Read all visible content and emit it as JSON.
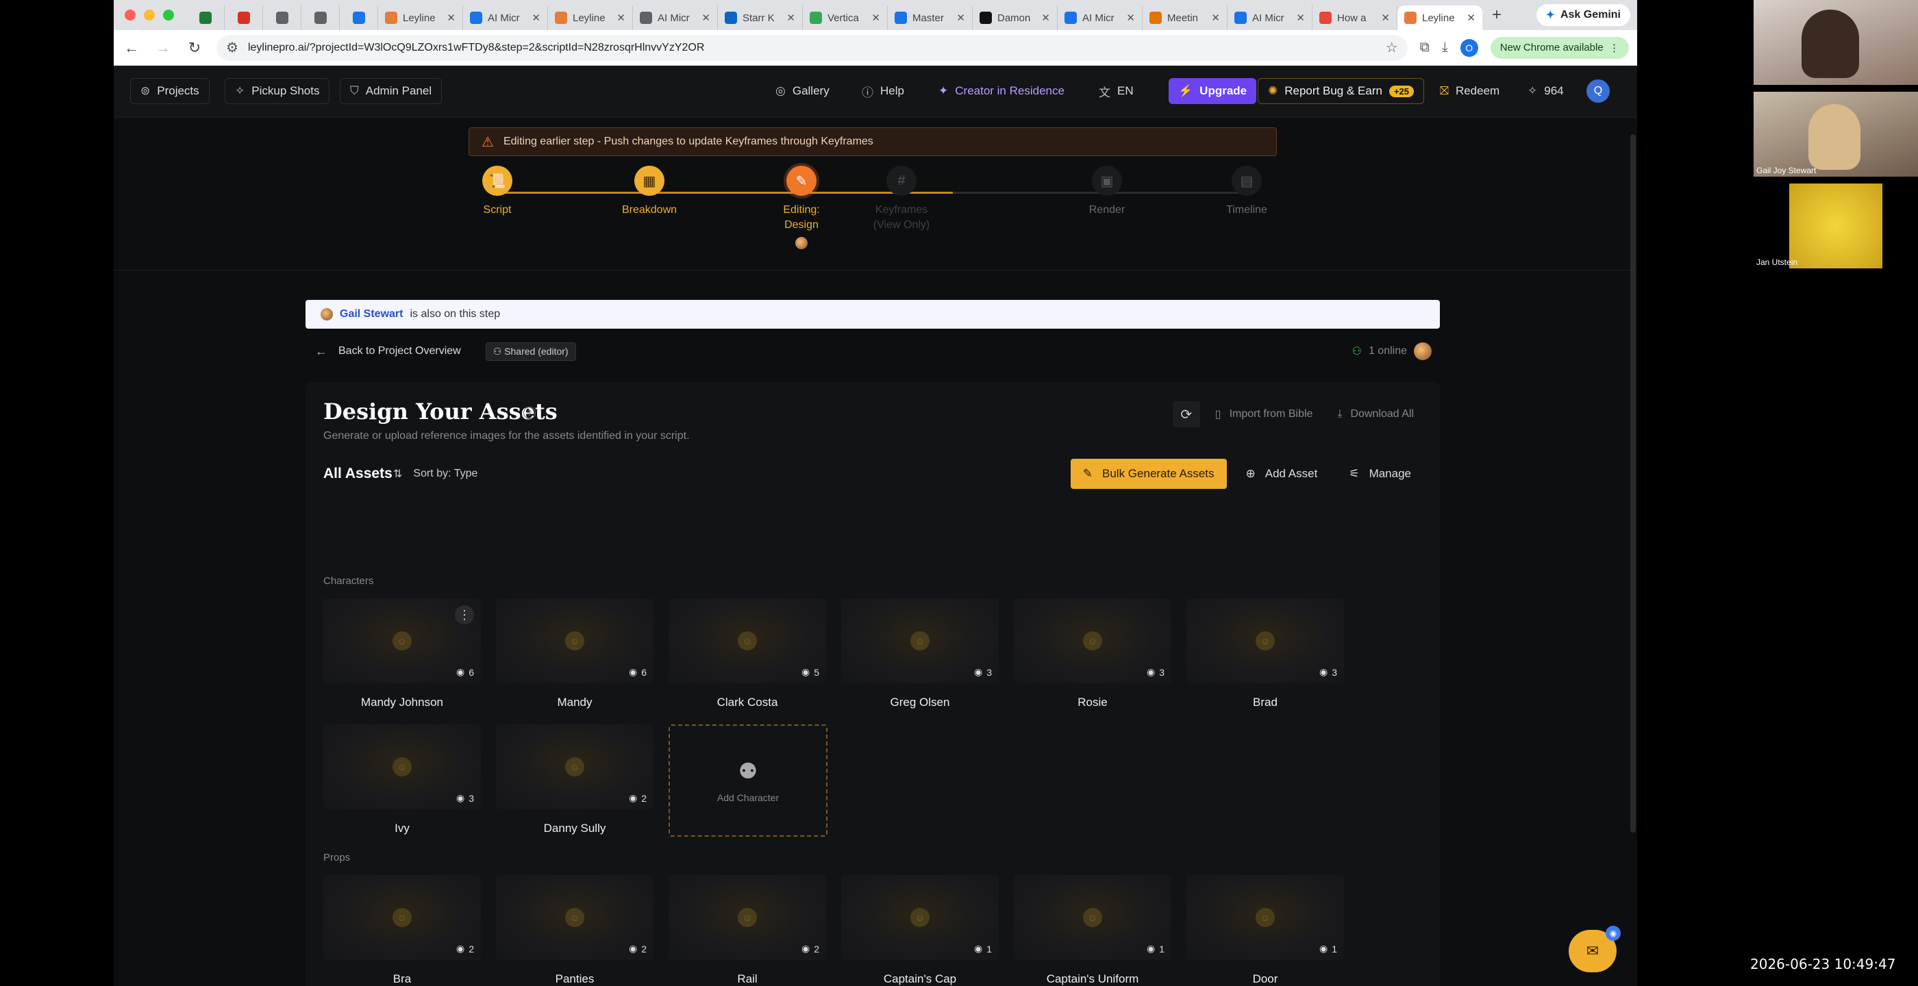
{
  "browser": {
    "tabs": [
      {
        "label": "",
        "color": "#1e7b3a",
        "mini": true
      },
      {
        "label": "",
        "color": "#d93025",
        "mini": true
      },
      {
        "label": "",
        "color": "#5f6368",
        "mini": true
      },
      {
        "label": "",
        "color": "#5f6368",
        "mini": true
      },
      {
        "label": "",
        "color": "#1a73e8",
        "mini": true
      },
      {
        "label": "Leyline",
        "color": "#e57c3a",
        "mini": false
      },
      {
        "label": "AI Micr",
        "color": "#1a73e8",
        "mini": false
      },
      {
        "label": "Leyline",
        "color": "#e57c3a",
        "mini": false
      },
      {
        "label": "AI Micr",
        "color": "#5f6368",
        "mini": false
      },
      {
        "label": "Starr K",
        "color": "#0a66c2",
        "mini": false
      },
      {
        "label": "Vertica",
        "color": "#34a853",
        "mini": false
      },
      {
        "label": "Master",
        "color": "#1a73e8",
        "mini": false
      },
      {
        "label": "Damon",
        "color": "#111111",
        "mini": false
      },
      {
        "label": "AI Micr",
        "color": "#1a73e8",
        "mini": false
      },
      {
        "label": "Meetin",
        "color": "#e37400",
        "mini": false
      },
      {
        "label": "AI Micr",
        "color": "#1a73e8",
        "mini": false
      },
      {
        "label": "How a",
        "color": "#e8453c",
        "mini": false
      },
      {
        "label": "Leyline",
        "color": "#e57c3a",
        "mini": false,
        "active": true
      }
    ],
    "ask_gemini": "Ask Gemini",
    "url": "leylinepro.ai/?projectId=W3lOcQ9LZOxrs1wFTDy8&step=2&scriptId=N28zrosqrHlnvvYzY2OR",
    "profile_letter": "O",
    "new_chrome": "New Chrome available"
  },
  "header": {
    "projects": "Projects",
    "pickup_shots": "Pickup Shots",
    "admin_panel": "Admin Panel",
    "gallery": "Gallery",
    "help": "Help",
    "creator": "Creator in Residence",
    "language": "EN",
    "upgrade": "Upgrade",
    "report": "Report Bug & Earn",
    "report_badge": "+25",
    "redeem": "Redeem",
    "credits": "964",
    "avatar_letter": "Q"
  },
  "warning": "Editing earlier step - Push changes to update Keyframes through Keyframes",
  "steps": [
    {
      "label": "Script",
      "sub": "",
      "state": "done",
      "icon": "📜"
    },
    {
      "label": "Breakdown",
      "sub": "",
      "state": "done",
      "icon": "▦"
    },
    {
      "label": "Editing:",
      "sub": "Design",
      "state": "current",
      "icon": "✎"
    },
    {
      "label": "Keyframes",
      "sub": "(View Only)",
      "state": "disabled",
      "icon": "#"
    },
    {
      "label": "Render",
      "sub": "",
      "state": "todo",
      "icon": "▣"
    },
    {
      "label": "Timeline",
      "sub": "",
      "state": "todo",
      "icon": "▤"
    }
  ],
  "presence": {
    "name": "Gail Stewart",
    "text": "is also on this step"
  },
  "back": {
    "label": "Back to Project Overview",
    "shared": "Shared (editor)",
    "online": "1 online"
  },
  "panel": {
    "title": "Design Your Assets",
    "subtitle": "Generate or upload reference images for the assets identified in your script.",
    "import": "Import from Bible",
    "download": "Download All",
    "all_assets": "All Assets",
    "sort": "Sort by: Type",
    "bulk": "Bulk Generate Assets",
    "add_asset": "Add Asset",
    "manage": "Manage"
  },
  "characters_label": "Characters",
  "characters": [
    {
      "name": "Mandy Johnson",
      "views": "6"
    },
    {
      "name": "Mandy",
      "views": "6"
    },
    {
      "name": "Clark Costa",
      "views": "5"
    },
    {
      "name": "Greg Olsen",
      "views": "3"
    },
    {
      "name": "Rosie",
      "views": "3"
    },
    {
      "name": "Brad",
      "views": "3"
    },
    {
      "name": "Ivy",
      "views": "3"
    },
    {
      "name": "Danny Sully",
      "views": "2"
    }
  ],
  "add_character": "Add Character",
  "props_label": "Props",
  "props": [
    {
      "name": "Bra",
      "views": "2"
    },
    {
      "name": "Panties",
      "views": "2"
    },
    {
      "name": "Rail",
      "views": "2"
    },
    {
      "name": "Captain's Cap",
      "views": "1"
    },
    {
      "name": "Captain's Uniform",
      "views": "1"
    },
    {
      "name": "Door",
      "views": "1"
    }
  ],
  "participants": [
    {
      "name": ""
    },
    {
      "name": "Gail Joy Stewart"
    },
    {
      "name": "Jan Utstein"
    }
  ],
  "timestamp": "2026-06-23  10:49:47",
  "colors": {
    "accent": "#f0ae2e",
    "current_step": "#f0762a",
    "upgrade": "#6b43f0"
  }
}
